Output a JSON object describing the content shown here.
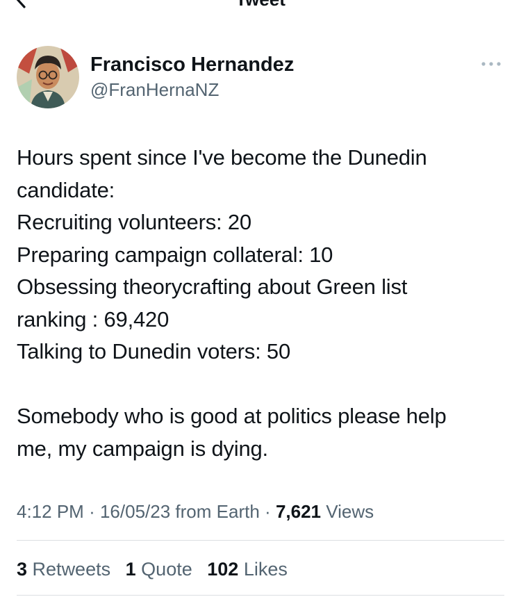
{
  "header": {
    "title": "Tweet"
  },
  "author": {
    "display_name": "Francisco Hernandez",
    "handle": "@FranHernaNZ"
  },
  "tweet": {
    "lines": [
      "Hours spent since I've become the Dunedin",
      "candidate:",
      "Recruiting volunteers: 20",
      "Preparing campaign collateral: 10",
      "Obsessing theorycrafting about Green list",
      "ranking : 69,420",
      "Talking to Dunedin voters: 50",
      "",
      "Somebody who is good at politics please help",
      "me, my campaign is dying."
    ]
  },
  "meta": {
    "time": "4:12 PM",
    "separator": "·",
    "date": "16/05/23",
    "source": "from Earth",
    "views_count": "7,621",
    "views_label": "Views"
  },
  "stats": {
    "retweets_count": "3",
    "retweets_label": "Retweets",
    "quotes_count": "1",
    "quotes_label": "Quote",
    "likes_count": "102",
    "likes_label": "Likes"
  },
  "icons": {
    "back": "chevron-left-icon",
    "more": "more-horizontal-icon"
  },
  "colors": {
    "text_primary": "#0f1419",
    "text_secondary": "#536471",
    "divider": "#dcdfe2"
  }
}
